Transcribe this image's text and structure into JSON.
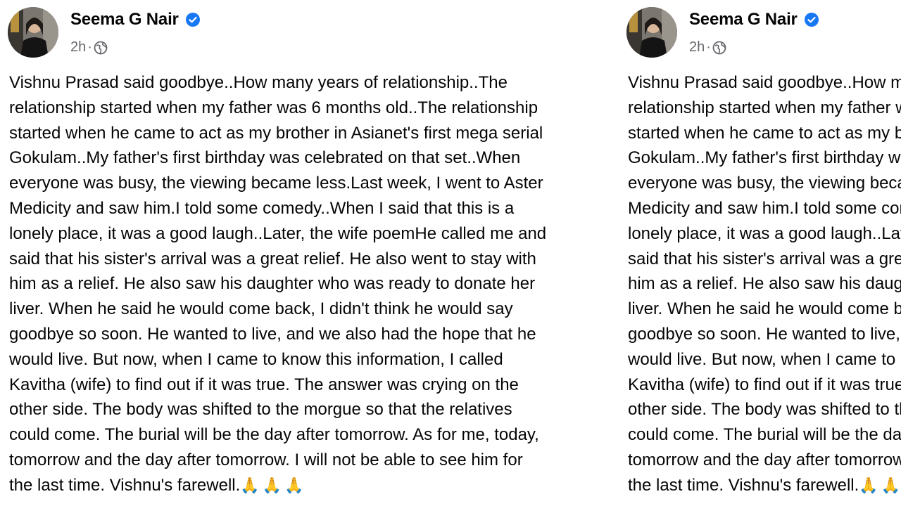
{
  "post": {
    "author": "Seema G Nair",
    "time": "2h",
    "verified_icon": "verified-badge-icon",
    "privacy_icon": "globe-icon",
    "text_lines": [
      "Vishnu Prasad said goodbye..How many years of relationship..The",
      "relationship started when my father was 6 months old..The relationship",
      "started when he came to act as my brother in Asianet's first mega serial",
      "Gokulam..My father's first birthday was celebrated on that set..When",
      "everyone was busy, the viewing became less.Last week, I went to Aster",
      "Medicity and saw him.I told some comedy..When I said that this is a",
      "lonely place, it was a good laugh..Later, the wife poemHe called me and",
      "said that his sister's arrival was a great relief. He also went to stay with",
      "him as a relief. He also saw his daughter who was ready to donate her",
      "liver. When he said he would come back, I didn't think he would say",
      "goodbye so soon. He wanted to live, and we also had the hope that he",
      "would live. But now, when I came to know this information, I called",
      "Kavitha (wife) to find out if it was true. The answer was crying on the",
      "other side. The body was shifted to the morgue so that the relatives",
      "could come. The burial will be the day after tomorrow. As for me, today,",
      "tomorrow and the day after tomorrow. I will not be able to see him for",
      "the last time. Vishnu's farewell."
    ],
    "emoji": "🙏🙏🙏"
  },
  "colors": {
    "verified_blue": "#1877f2",
    "meta_gray": "#65676b",
    "text": "#050505"
  }
}
